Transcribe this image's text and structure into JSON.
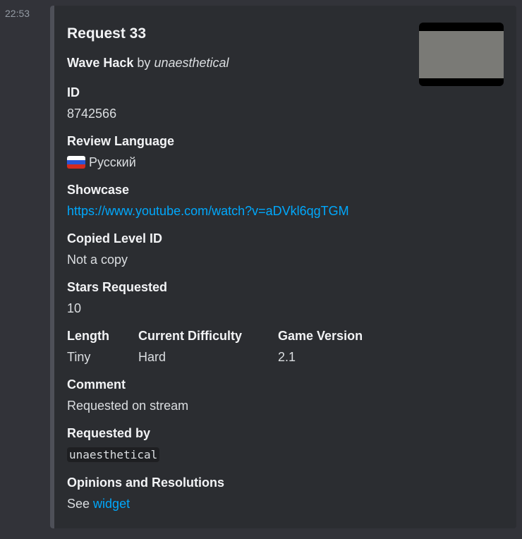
{
  "timestamp": "22:53",
  "embed": {
    "title": "Request 33",
    "level_name": "Wave Hack",
    "by_word": "by",
    "author": "unaesthetical",
    "fields": {
      "id": {
        "name": "ID",
        "value": "8742566"
      },
      "review_language": {
        "name": "Review Language",
        "value": "Русский",
        "flag": "russia-flag"
      },
      "showcase": {
        "name": "Showcase",
        "value": "https://www.youtube.com/watch?v=aDVkl6qgTGM"
      },
      "copied_level_id": {
        "name": "Copied Level ID",
        "value": "Not a copy"
      },
      "stars_requested": {
        "name": "Stars Requested",
        "value": "10"
      },
      "length": {
        "name": "Length",
        "value": "Tiny"
      },
      "current_difficulty": {
        "name": "Current Difficulty",
        "value": "Hard"
      },
      "game_version": {
        "name": "Game Version",
        "value": "2.1"
      },
      "comment": {
        "name": "Comment",
        "value": "Requested on stream"
      },
      "requested_by": {
        "name": "Requested by",
        "value": "unaesthetical"
      },
      "opinions": {
        "name": "Opinions and Resolutions",
        "prefix": "See",
        "link": "widget"
      }
    },
    "colors": {
      "link": "#00a8fc",
      "embed_bar": "#4e5058",
      "embed_bg": "#2b2d31"
    }
  }
}
